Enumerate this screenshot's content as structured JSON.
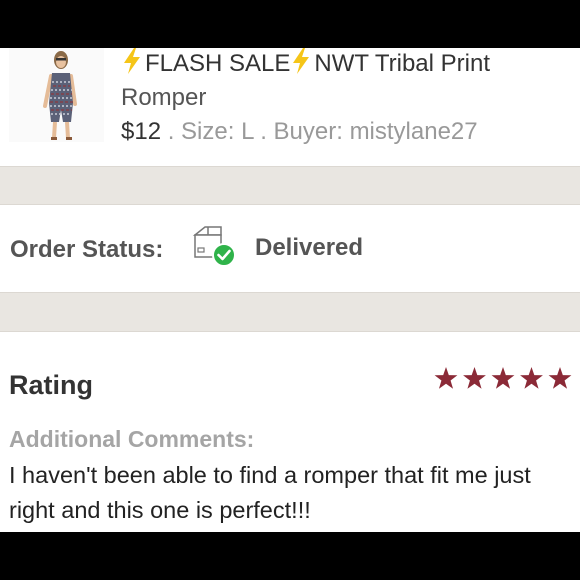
{
  "product": {
    "flash_sale": "FLASH SALE",
    "title_rest": "NWT Tribal Print",
    "title_line2": "Romper",
    "price": "$12",
    "meta": " . Size: L . Buyer: mistylane27"
  },
  "order": {
    "status_label": "Order Status:",
    "status_value": "Delivered",
    "status_icon": "package-delivered-icon"
  },
  "review": {
    "rating_label": "Rating",
    "stars": 5,
    "comments_label": "Additional Comments:",
    "comment_text": "I haven't been able to find a romper that fit me just right and this one is perfect!!!"
  },
  "colors": {
    "star": "#8b2a37",
    "check": "#2fb34a",
    "bolt": "#f5c518"
  }
}
